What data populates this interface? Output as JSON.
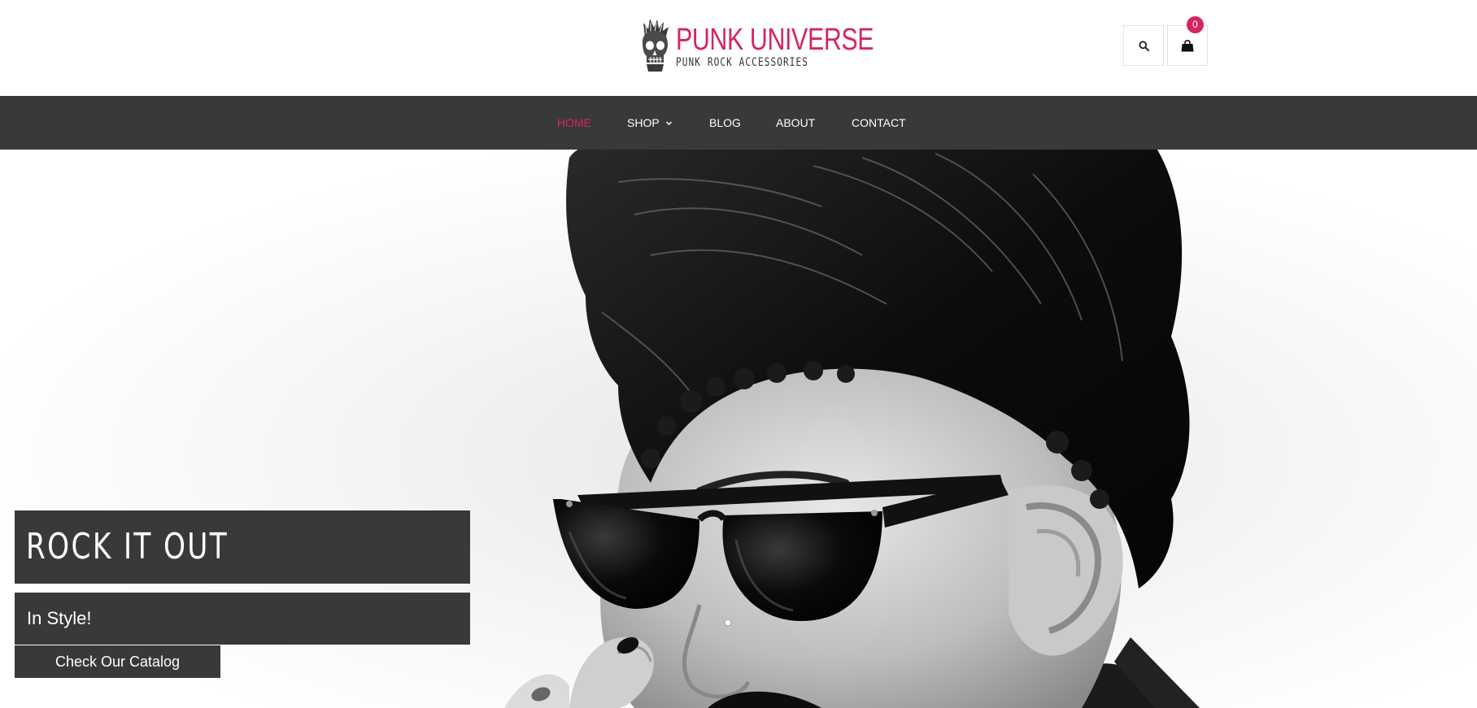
{
  "header": {
    "logo_title": "PUNK UNIVERSE",
    "logo_subtitle": "PUNK ROCK ACCESSORIES",
    "search_icon": "search-icon",
    "cart_icon": "shopping-bag-icon",
    "cart_count": "0"
  },
  "nav": {
    "items": [
      {
        "label": "HOME",
        "active": true
      },
      {
        "label": "SHOP",
        "has_dropdown": true
      },
      {
        "label": "BLOG"
      },
      {
        "label": "ABOUT"
      },
      {
        "label": "CONTACT"
      }
    ]
  },
  "hero": {
    "title": "ROCK IT OUT",
    "subtitle": "In Style!",
    "button_label": "Check Our Catalog"
  },
  "colors": {
    "accent": "#d6255e",
    "dark": "#393939",
    "white": "#ffffff"
  }
}
